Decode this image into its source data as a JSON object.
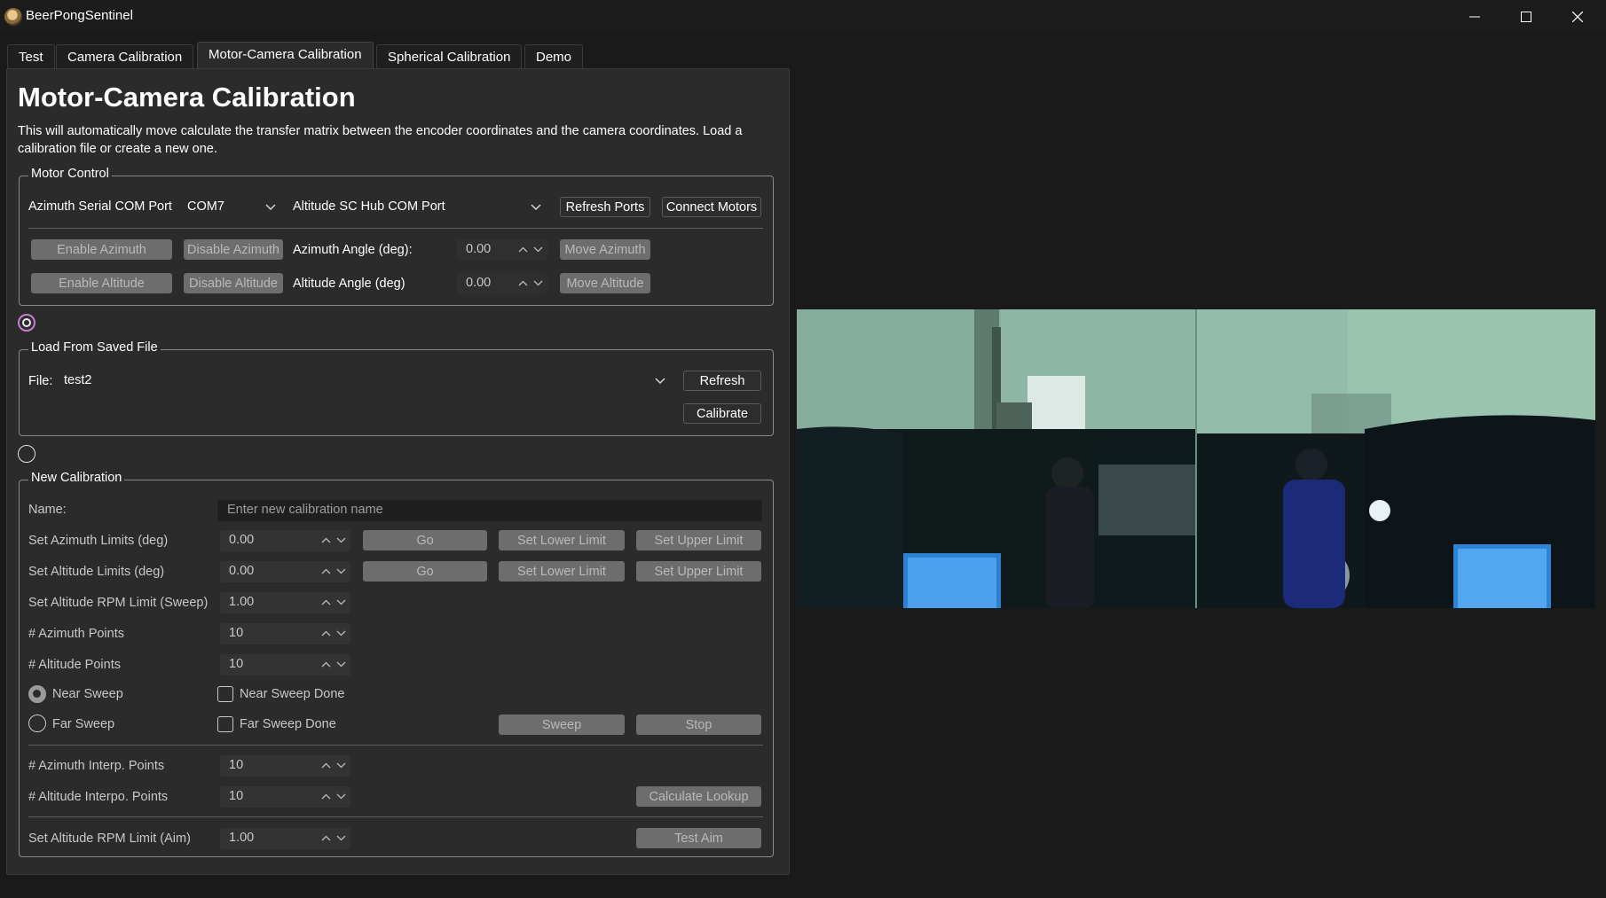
{
  "window": {
    "title": "BeerPongSentinel"
  },
  "tabs": [
    {
      "label": "Test"
    },
    {
      "label": "Camera Calibration"
    },
    {
      "label": "Motor-Camera Calibration",
      "active": true
    },
    {
      "label": "Spherical Calibration"
    },
    {
      "label": "Demo"
    }
  ],
  "page": {
    "title": "Motor-Camera Calibration",
    "description": "This will automatically move calculate the transfer matrix between the encoder coordinates and the camera coordinates. Load a calibration file or create a new one."
  },
  "motor_control": {
    "legend": "Motor Control",
    "azimuth_port_label": "Azimuth Serial COM Port",
    "azimuth_port_value": "COM7",
    "altitude_port_label": "Altitude SC Hub COM Port",
    "altitude_port_value": "",
    "refresh_ports": "Refresh Ports",
    "connect_motors": "Connect Motors",
    "enable_azimuth": "Enable Azimuth",
    "disable_azimuth": "Disable Azimuth",
    "azimuth_angle_label": "Azimuth Angle (deg):",
    "azimuth_angle_value": "0.00",
    "move_azimuth": "Move Azimuth",
    "enable_altitude": "Enable Altitude",
    "disable_altitude": "Disable Altitude",
    "altitude_angle_label": "Altitude Angle (deg)",
    "altitude_angle_value": "0.00",
    "move_altitude": "Move Altitude"
  },
  "load_saved": {
    "legend": "Load From Saved File",
    "file_label": "File:",
    "file_value": "test2",
    "refresh": "Refresh",
    "calibrate": "Calibrate"
  },
  "new_calibration": {
    "legend": "New Calibration",
    "name_label": "Name:",
    "name_placeholder": "Enter new calibration name",
    "az_limits_label": "Set Azimuth Limits (deg)",
    "az_limits_value": "0.00",
    "alt_limits_label": "Set Altitude Limits (deg)",
    "alt_limits_value": "0.00",
    "go": "Go",
    "set_lower": "Set Lower Limit",
    "set_upper": "Set Upper Limit",
    "rpm_sweep_label": "Set Altitude RPM Limit (Sweep)",
    "rpm_sweep_value": "1.00",
    "az_points_label": "# Azimuth Points",
    "az_points_value": "10",
    "alt_points_label": "# Altitude Points",
    "alt_points_value": "10",
    "near_sweep": "Near Sweep",
    "near_sweep_done": "Near Sweep Done",
    "far_sweep": "Far Sweep",
    "far_sweep_done": "Far Sweep Done",
    "sweep": "Sweep",
    "stop": "Stop",
    "az_interp_label": "# Azimuth Interp. Points",
    "az_interp_value": "10",
    "alt_interp_label": "# Altitude Interpo. Points",
    "alt_interp_value": "10",
    "calculate_lookup": "Calculate Lookup",
    "rpm_aim_label": "Set Altitude RPM Limit (Aim)",
    "rpm_aim_value": "1.00",
    "test_aim": "Test Aim"
  },
  "colors": {
    "background": "#1a1a1a",
    "panel": "#2b2b2b",
    "accent_radio": "#c77dd3",
    "disabled_button": "#6d6d6d"
  }
}
